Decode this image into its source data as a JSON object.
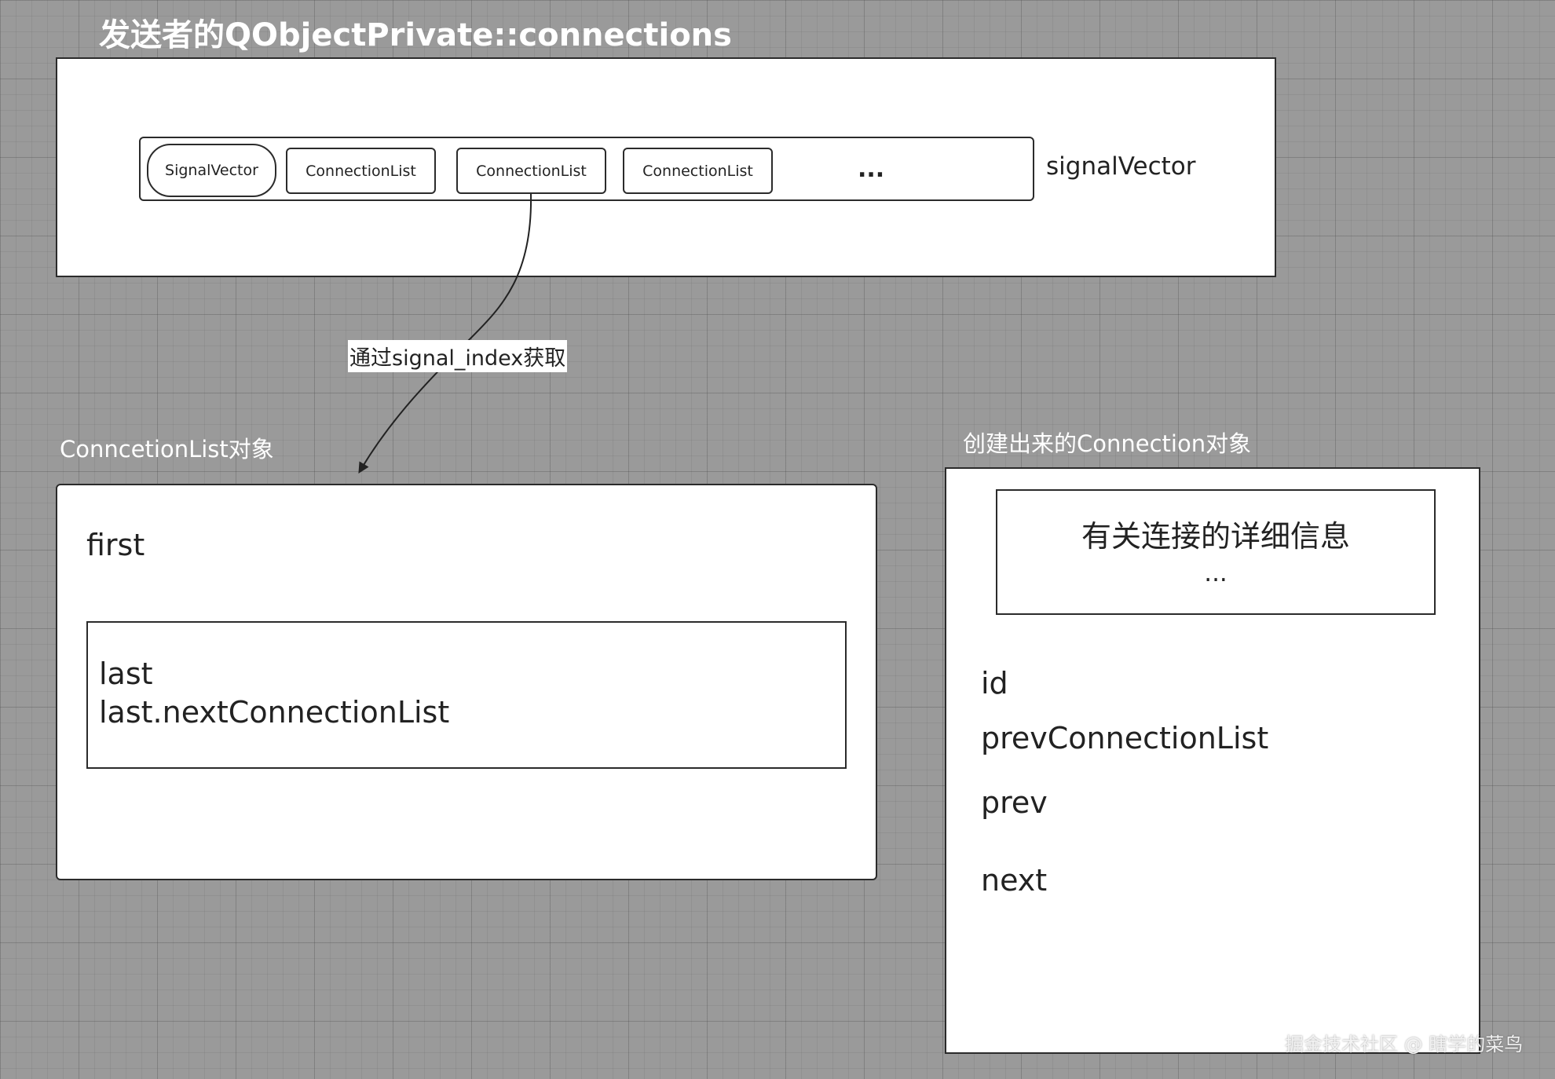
{
  "title": "发送者的QObjectPrivate::connections",
  "connections_box": {
    "items": [
      "SignalVector",
      "ConnectionList",
      "ConnectionList",
      "ConnectionList"
    ],
    "ellipsis": "...",
    "side_label": "signalVector"
  },
  "edge_label": "通过signal_index获取",
  "connection_list_section": {
    "heading": "ConncetionList对象",
    "first": "first",
    "inner_line1": "last",
    "inner_line2": "last.nextConnectionList"
  },
  "connection_section": {
    "heading": "创建出来的Connection对象",
    "detail_line1": "有关连接的详细信息",
    "detail_line2": "...",
    "fields": [
      "id",
      "prevConnectionList",
      "prev",
      "next"
    ]
  },
  "watermark": "掘金技术社区 @ 瞎学的菜鸟",
  "colors": {
    "background": "#9a9a9a",
    "box_fill": "#ffffff",
    "stroke": "#2b2b2b"
  }
}
